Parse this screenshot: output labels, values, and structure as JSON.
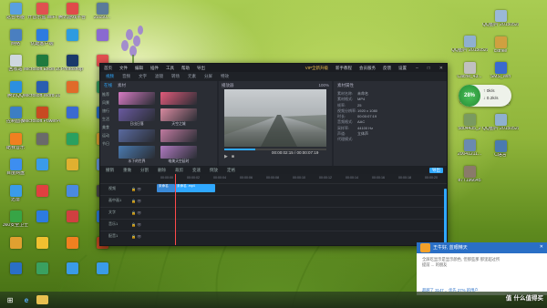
{
  "desktop": {
    "left_col1": [
      {
        "label": "这台电脑",
        "color": "#5aa0e0"
      },
      {
        "label": "网络",
        "color": "#4a7fc0"
      },
      {
        "label": "回收站",
        "color": "#cfd8e0"
      },
      {
        "label": "腾讯QQ",
        "color": "#2b8fe0"
      },
      {
        "label": "控制面板",
        "color": "#3c7ec4"
      },
      {
        "label": "酷我音乐",
        "color": "#f08020"
      },
      {
        "label": "百度网盘",
        "color": "#3d8ef0"
      },
      {
        "label": "迅雷",
        "color": "#3a9be8"
      },
      {
        "label": "360安全卫士",
        "color": "#37a546"
      },
      {
        "label": "",
        "color": "#e0a030"
      },
      {
        "label": "",
        "color": "#2a6fc6"
      }
    ],
    "left_col2": [
      {
        "label": "开音乐盒 WiFi",
        "color": "#e05050"
      },
      {
        "label": "优酷客户端",
        "color": "#2d7be0"
      },
      {
        "label": "Microsoft Excel 2010",
        "color": "#1f7a3e"
      },
      {
        "label": "Microsoft Word 2010",
        "color": "#2a5db0"
      },
      {
        "label": "Microsoft PowerPoint",
        "color": "#c84a22"
      },
      {
        "label": "",
        "color": "#6a6a6a"
      },
      {
        "label": "",
        "color": "#3a9be8"
      },
      {
        "label": "",
        "color": "#e04040"
      },
      {
        "label": "",
        "color": "#2d7be0"
      },
      {
        "label": "",
        "color": "#f0c030"
      },
      {
        "label": "",
        "color": "#3aa060"
      }
    ],
    "left_col3": [
      {
        "label": "腾讯游戏平台",
        "color": "#e04a4a"
      },
      {
        "label": "",
        "color": "#2d9be0"
      },
      {
        "label": "Photoshop",
        "color": "#1a3a6a"
      },
      {
        "label": "",
        "color": "#e06a2a"
      },
      {
        "label": "",
        "color": "#3a6ad0"
      },
      {
        "label": "",
        "color": "#2aa060"
      },
      {
        "label": "",
        "color": "#e0b030"
      },
      {
        "label": "",
        "color": "#4a8ae0"
      },
      {
        "label": "",
        "color": "#d04040"
      },
      {
        "label": "",
        "color": "#f08020"
      },
      {
        "label": "",
        "color": "#3a9be8"
      }
    ],
    "left_col4": [
      {
        "label": "20150...",
        "color": "#5a7a9a"
      },
      {
        "label": "",
        "color": "#8a6ad0"
      },
      {
        "label": "",
        "color": "#e05050"
      },
      {
        "label": "",
        "color": "#3aa060"
      },
      {
        "label": "",
        "color": "#2a6fc6"
      },
      {
        "label": "",
        "color": "#e0a030"
      },
      {
        "label": "",
        "color": "#6a9ae0"
      },
      {
        "label": "",
        "color": "#4a4a4a"
      },
      {
        "label": "",
        "color": "#2d7be0"
      },
      {
        "label": "",
        "color": "#c84a22"
      },
      {
        "label": "",
        "color": "#3a9be8"
      }
    ],
    "right_col1": [
      {
        "label": "QQ图片 20150529...",
        "color": "#8fb0d0"
      },
      {
        "label": "Cache_43...",
        "color": "#c0c0c0"
      },
      {
        "label": "empires2",
        "color": "#b08040"
      },
      {
        "label": "5804435_2",
        "color": "#7a9a60"
      },
      {
        "label": "20041211...",
        "color": "#6a8ab0"
      },
      {
        "label": "e77196645",
        "color": "#8a7a6a"
      }
    ],
    "right_col2": [
      {
        "label": "QQ图片 20150529...",
        "color": "#9ab8d8"
      },
      {
        "label": "cstrike",
        "color": "#d0a040"
      },
      {
        "label": "SMS_Win",
        "color": "#3a6ad0"
      },
      {
        "label": "英雄联盟",
        "color": "#c8a040"
      },
      {
        "label": "QQ图片 20150529",
        "color": "#8fb0d0"
      },
      {
        "label": "C语言",
        "color": "#4a7ab0"
      }
    ]
  },
  "editor": {
    "title_items": [
      "首页",
      "文件",
      "编辑",
      "插件",
      "工具",
      "帮助",
      "导出"
    ],
    "vip_label": "VIP全新升级",
    "title_right": [
      "新手教程",
      "会员服务",
      "反馈",
      "设置"
    ],
    "tabs": [
      "视频",
      "音频",
      "文字",
      "滤镜",
      "转场",
      "元素",
      "分屏",
      "特效"
    ],
    "panel_tabs": [
      "在线",
      "素材"
    ],
    "categories": [
      "推荐",
      "风景",
      "旅行",
      "生活",
      "美食",
      "运动",
      "节日"
    ],
    "thumbs": [
      {
        "caption": "",
        "color": "#d77bc4"
      },
      {
        "caption": "",
        "color": "#e05a7a"
      },
      {
        "caption": "日出日落",
        "color": "#6a5aa0"
      },
      {
        "caption": "天空之城",
        "color": "#d88aa0"
      },
      {
        "caption": "",
        "color": "#5a6aa0"
      },
      {
        "caption": "",
        "color": "#c07aa0"
      },
      {
        "caption": "水下的世界",
        "color": "#4a7ab0"
      },
      {
        "caption": "唯美天空延时",
        "color": "#b07ac0"
      }
    ],
    "preview": {
      "label": "播放器",
      "zoom": "100%",
      "time_current": "00:00:02:15",
      "time_total": "00:00:07:19"
    },
    "properties": {
      "title": "素材属性",
      "rows": [
        {
          "k": "素材名称:",
          "v": "未命名"
        },
        {
          "k": "素材格式:",
          "v": "MP4"
        },
        {
          "k": "帧率:",
          "v": "25"
        },
        {
          "k": "视频分辨率:",
          "v": "1920 x 1080"
        },
        {
          "k": "时长:",
          "v": "00:00:07:19"
        },
        {
          "k": "音频格式:",
          "v": "AAC"
        },
        {
          "k": "采样率:",
          "v": "44100 Hz"
        },
        {
          "k": "声道:",
          "v": "立体声"
        },
        {
          "k": "代理模式:",
          "v": ""
        }
      ]
    },
    "edit_bar": [
      "撤销",
      "重做",
      "分割",
      "删除",
      "裁剪",
      "变速",
      "倒放",
      "定格"
    ],
    "export_label": "导出",
    "ruler_ticks": [
      "00:00:00",
      "00:00:02",
      "00:00:04",
      "00:00:06",
      "00:00:08",
      "00:00:10",
      "00:00:12",
      "00:00:14",
      "00:00:16",
      "00:00:18",
      "00:00:20",
      "00:00:22",
      "00:00:24",
      "00:00:26"
    ],
    "tracks": [
      {
        "name": "视频"
      },
      {
        "name": "画中画1"
      },
      {
        "name": "文字"
      },
      {
        "name": "音乐1"
      },
      {
        "name": "配音1"
      }
    ],
    "clips": [
      {
        "label": "未命名",
        "color": "#3a8ad8"
      },
      {
        "label": "未命名 .mp4",
        "color": "#2fa8ff"
      }
    ]
  },
  "speed_widget": {
    "percent": "28%",
    "up": "0k/s",
    "down": "0.2k/s"
  },
  "notification": {
    "header": "王牛好, 蓝眼精天",
    "body_line1": "全屏吃显示是显示颜色, 但那些那 那里超过所",
    "body_line2": "提前 ... 的朋友",
    "footer": "超越了 3147 ，优先 27% 的用户"
  },
  "taskbar": {
    "items": [
      "start",
      "ie",
      "folder"
    ]
  },
  "watermark": "值 什么值得买"
}
